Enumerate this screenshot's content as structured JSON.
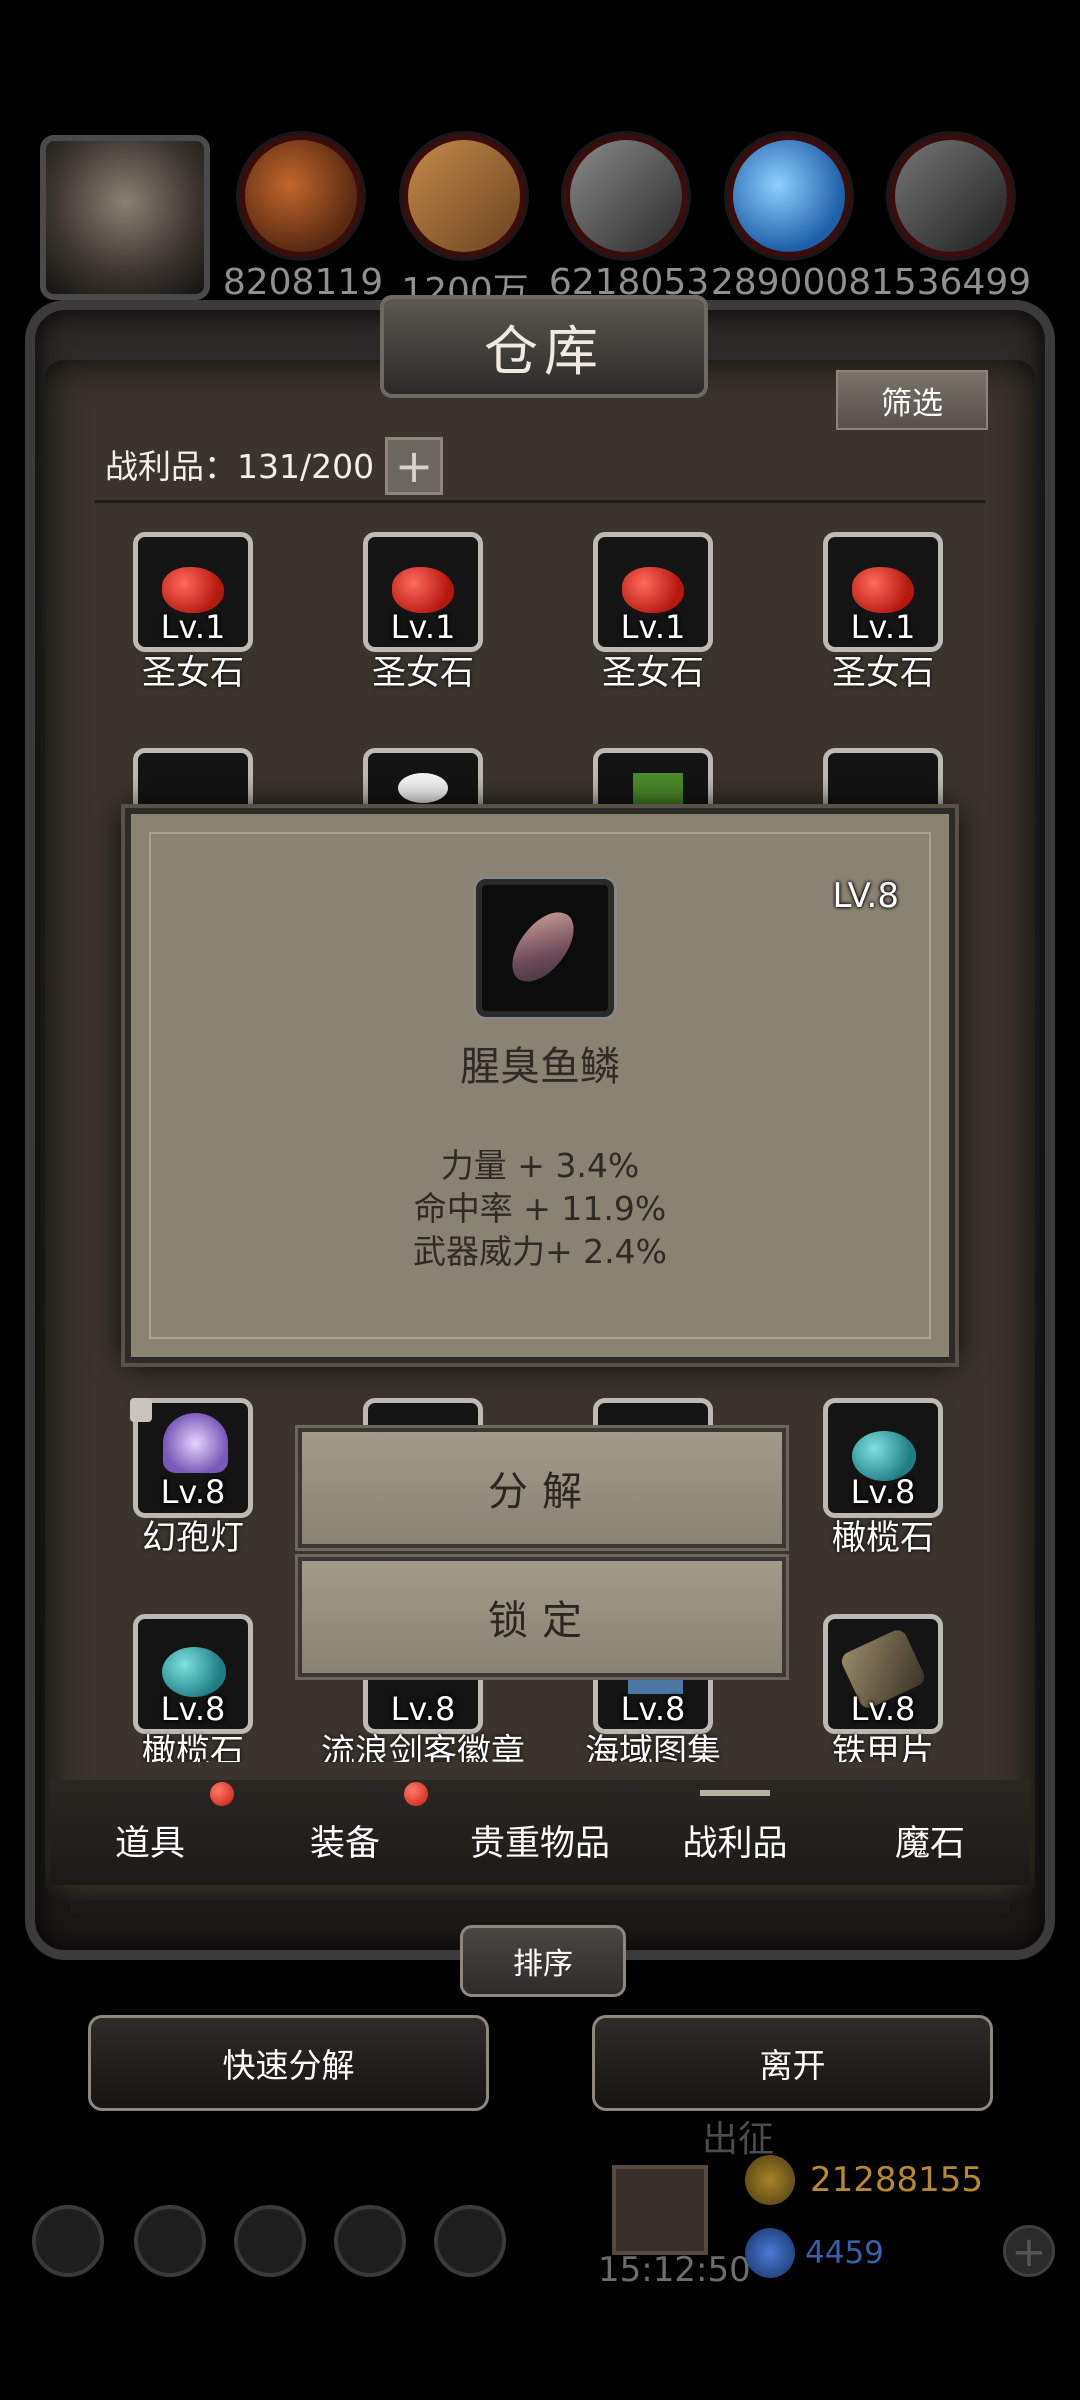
{
  "resources": [
    {
      "icon": "meat-icon",
      "value": "8208119"
    },
    {
      "icon": "wood-icon",
      "value": "1200万"
    },
    {
      "icon": "iron-icon",
      "value": "6218053"
    },
    {
      "icon": "crystal-icon",
      "value": "2890008"
    },
    {
      "icon": "steel-icon",
      "value": "1536499"
    }
  ],
  "panel": {
    "title": "仓库",
    "filter_label": "筛选",
    "capacity_label": "战利品：131/200",
    "plus_label": "+"
  },
  "grid": {
    "row1": [
      {
        "level": "Lv.1",
        "name": "圣女石"
      },
      {
        "level": "Lv.1",
        "name": "圣女石"
      },
      {
        "level": "Lv.1",
        "name": "圣女石"
      },
      {
        "level": "Lv.1",
        "name": "圣女石"
      }
    ],
    "row5": [
      {
        "level": "Lv.8",
        "name": "幻孢灯"
      },
      {
        "level": "",
        "name": ""
      },
      {
        "level": "",
        "name": ""
      },
      {
        "level": "Lv.8",
        "name": "橄榄石"
      }
    ],
    "row6": [
      {
        "level": "Lv.8",
        "name": "橄榄石"
      },
      {
        "level": "Lv.8",
        "name": "流浪剑客徽章"
      },
      {
        "level": "Lv.8",
        "name": "海域图集"
      },
      {
        "level": "Lv.8",
        "name": "铁甲片"
      }
    ]
  },
  "tooltip": {
    "level": "LV.8",
    "name": "腥臭鱼鳞",
    "stats": [
      "力量 + 3.4%",
      "命中率 + 11.9%",
      "武器威力+ 2.4%"
    ]
  },
  "actions": {
    "decompose": "分解",
    "lock": "锁定"
  },
  "tabs": [
    "道具",
    "装备",
    "贵重物品",
    "战利品",
    "魔石"
  ],
  "tab_badges": {
    "道具": true,
    "装备": true
  },
  "active_tab": "战利品",
  "sort_label": "排序",
  "quick_decompose_label": "快速分解",
  "leave_label": "离开",
  "hud": {
    "expedition_label": "出征",
    "gold": "21288155",
    "gems": "4459",
    "timer": "15:12:50"
  }
}
